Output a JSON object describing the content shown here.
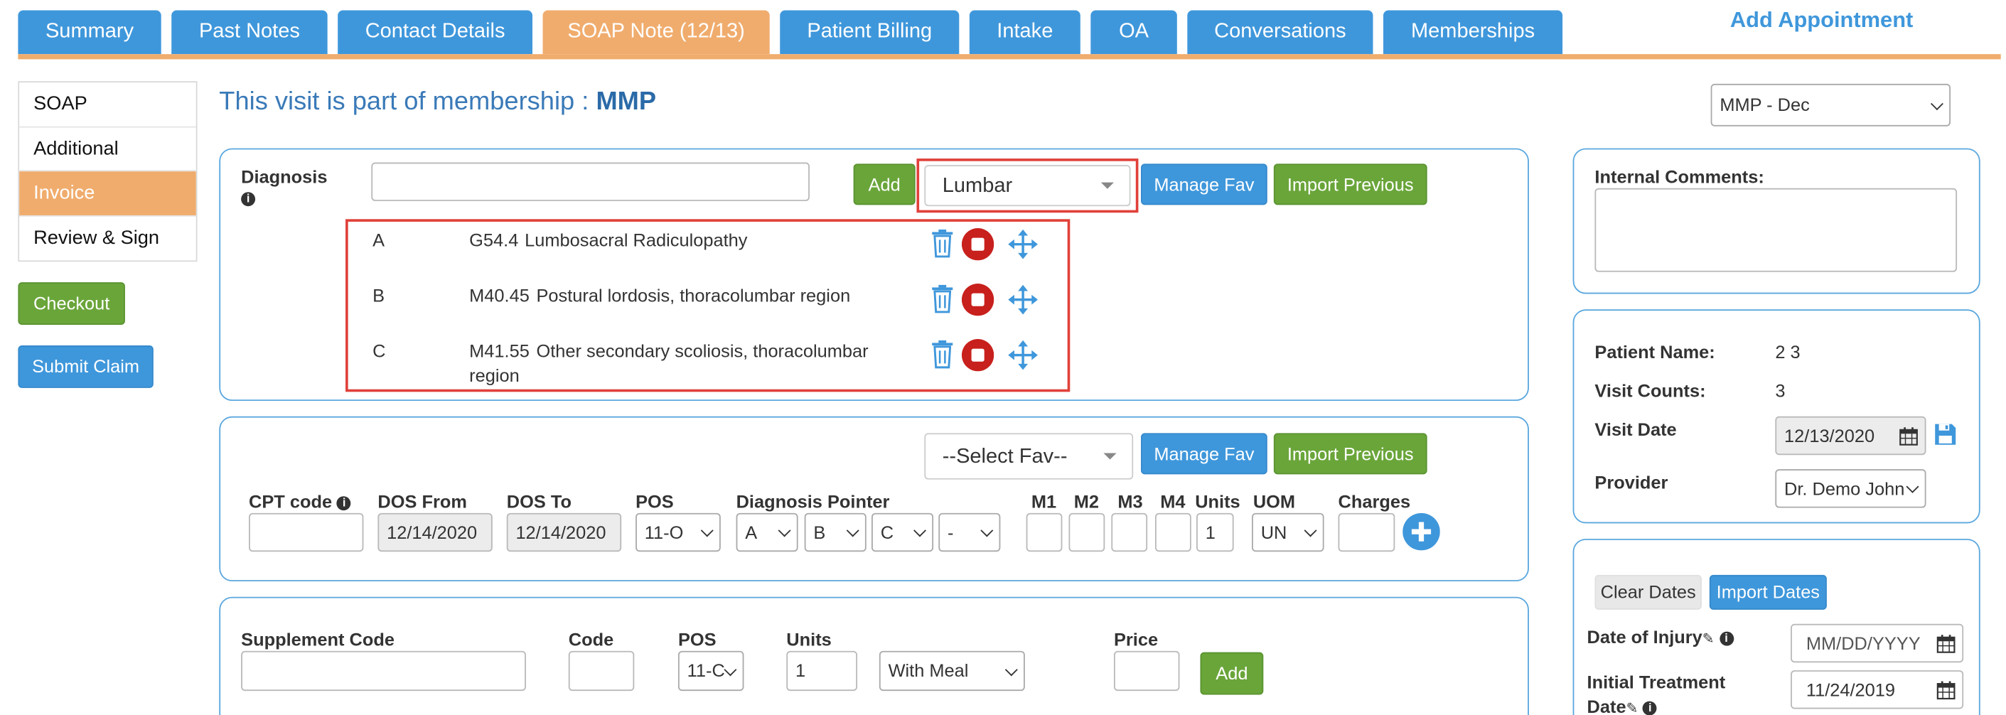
{
  "tabs": [
    {
      "label": "Summary",
      "active": false
    },
    {
      "label": "Past Notes",
      "active": false
    },
    {
      "label": "Contact Details",
      "active": false
    },
    {
      "label": "SOAP Note (12/13)",
      "active": true
    },
    {
      "label": "Patient Billing",
      "active": false
    },
    {
      "label": "Intake",
      "active": false
    },
    {
      "label": "OA",
      "active": false
    },
    {
      "label": "Conversations",
      "active": false
    },
    {
      "label": "Memberships",
      "active": false
    }
  ],
  "add_appointment": "Add Appointment",
  "side_menu": [
    {
      "label": "SOAP",
      "active": false
    },
    {
      "label": "Additional",
      "active": false
    },
    {
      "label": "Invoice",
      "active": true
    },
    {
      "label": "Review & Sign",
      "active": false
    }
  ],
  "checkout_label": "Checkout",
  "submit_claim_label": "Submit Claim",
  "membership_title_prefix": "This visit is part of membership : ",
  "membership_title_name": "MMP",
  "membership_select": "MMP - Dec",
  "diagnosis": {
    "label": "Diagnosis",
    "input_value": "",
    "add_label": "Add",
    "fav_select": "Lumbar",
    "manage_fav_label": "Manage Fav",
    "import_previous_label": "Import Previous",
    "items": [
      {
        "letter": "A",
        "code": "G54.4",
        "description": "Lumbosacral Radiculopathy"
      },
      {
        "letter": "B",
        "code": "M40.45",
        "description": "Postural lordosis, thoracolumbar region"
      },
      {
        "letter": "C",
        "code": "M41.55",
        "description": "Other secondary scoliosis, thoracolumbar",
        "description_line2": "region"
      }
    ]
  },
  "cpt": {
    "fav_select": "--Select Fav--",
    "manage_fav_label": "Manage Fav",
    "import_previous_label": "Import Previous",
    "headers": {
      "cpt_code": "CPT code",
      "dos_from": "DOS From",
      "dos_to": "DOS To",
      "pos": "POS",
      "diagnosis_pointer": "Diagnosis Pointer",
      "m1": "M1",
      "m2": "M2",
      "m3": "M3",
      "m4": "M4",
      "units": "Units",
      "uom": "UOM",
      "charges": "Charges"
    },
    "values": {
      "cpt_code": "",
      "dos_from": "12/14/2020",
      "dos_to": "12/14/2020",
      "pos": "11-O",
      "pointers": [
        "A",
        "B",
        "C",
        "-"
      ],
      "units": "1",
      "uom": "UN",
      "charges": ""
    }
  },
  "supplement": {
    "headers": {
      "supplement_code": "Supplement Code",
      "code": "Code",
      "pos": "POS",
      "units": "Units",
      "price": "Price"
    },
    "values": {
      "supplement_code": "",
      "code": "",
      "pos": "11-C",
      "units": "1",
      "meal": "With Meal",
      "price": ""
    },
    "add_label": "Add"
  },
  "internal_comments": {
    "label": "Internal Comments:",
    "value": ""
  },
  "patient": {
    "name_label": "Patient Name:",
    "name_value": "2 3",
    "visit_counts_label": "Visit Counts:",
    "visit_counts_value": "3",
    "visit_date_label": "Visit Date",
    "visit_date_value": "12/13/2020",
    "provider_label": "Provider",
    "provider_value": "Dr. Demo John"
  },
  "dates": {
    "clear_label": "Clear Dates",
    "import_label": "Import Dates",
    "injury_label": "Date of Injury",
    "injury_placeholder": "MM/DD/YYYY",
    "initial_label_line1": "Initial Treatment",
    "initial_label_line2": "Date",
    "initial_value": "11/24/2019"
  },
  "colors": {
    "tab_blue": "#3f97db",
    "tab_active": "#f0ac6d",
    "green": "#6aa53a",
    "highlight_red": "#e0413a"
  }
}
